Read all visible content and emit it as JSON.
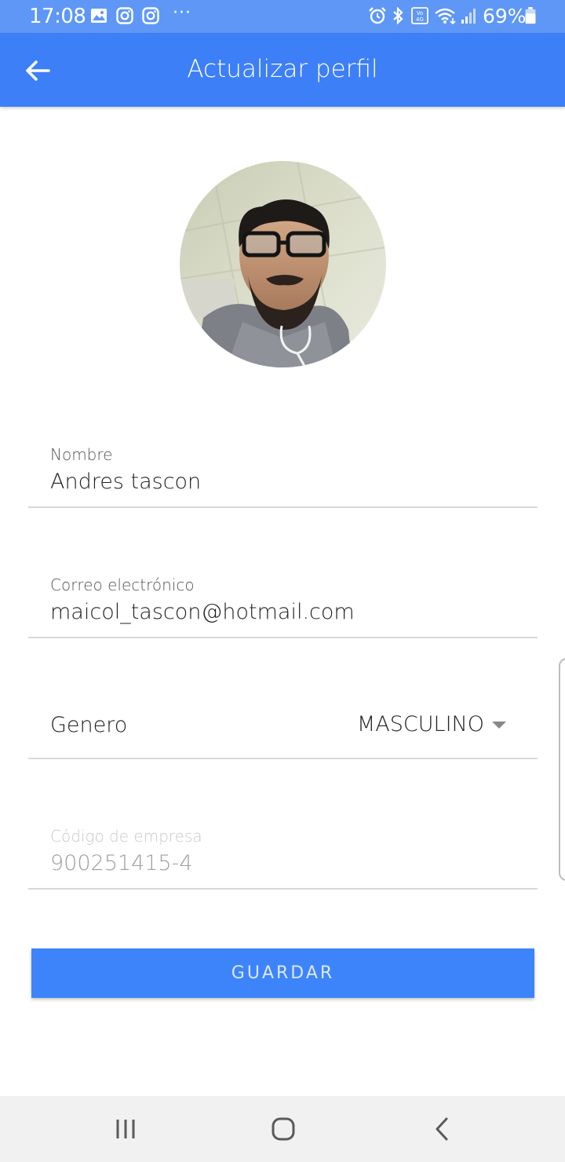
{
  "status_bar": {
    "time": "17:08",
    "more": "···",
    "battery": "69%",
    "icons": [
      "gallery-icon",
      "instagram-icon",
      "instagram-icon",
      "alarm-icon",
      "bluetooth-icon",
      "volte-icon",
      "wifi-icon",
      "signal-icon",
      "battery-icon"
    ]
  },
  "app_bar": {
    "title": "Actualizar perfil",
    "color": "#3d7ff7"
  },
  "form": {
    "nombre": {
      "label": "Nombre",
      "value": "Andres tascon"
    },
    "correo": {
      "label": "Correo electrónico",
      "value": "maicol_tascon@hotmail.com"
    },
    "genero": {
      "label": "Genero",
      "value": "MASCULINO"
    },
    "codigo": {
      "label": "Código de empresa",
      "value": "900251415-4"
    }
  },
  "save_label": "GUARDAR",
  "accent_color": "#3d84fa"
}
